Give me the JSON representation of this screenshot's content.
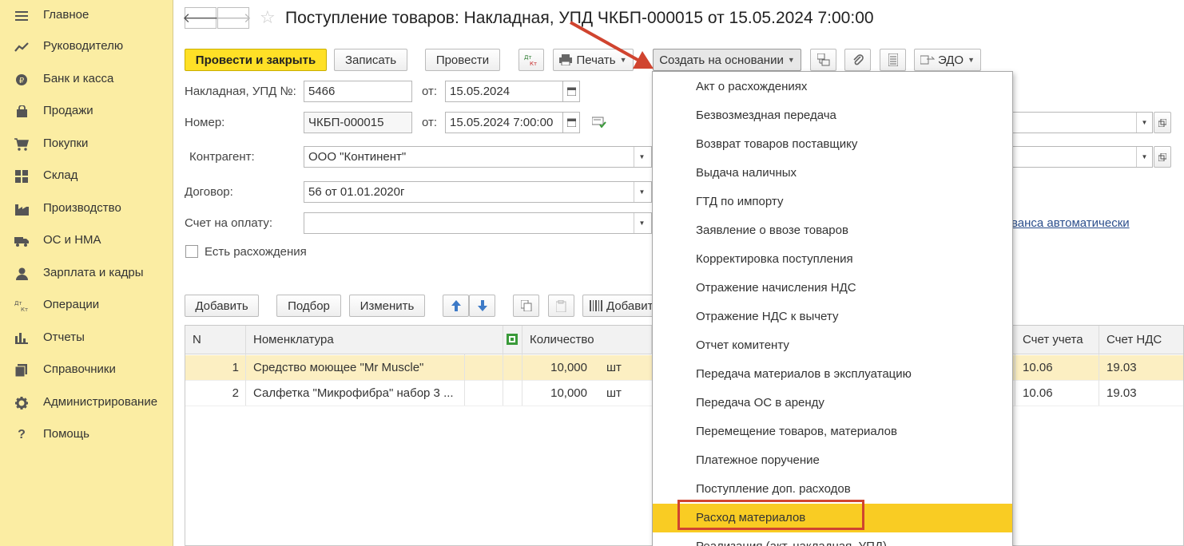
{
  "sidebar": {
    "items": [
      {
        "label": "Главное",
        "icon": "menu-icon"
      },
      {
        "label": "Руководителю",
        "icon": "trend-icon"
      },
      {
        "label": "Банк и касса",
        "icon": "coin-icon"
      },
      {
        "label": "Продажи",
        "icon": "shopping-bag-icon"
      },
      {
        "label": "Покупки",
        "icon": "cart-icon"
      },
      {
        "label": "Склад",
        "icon": "warehouse-icon"
      },
      {
        "label": "Производство",
        "icon": "factory-icon"
      },
      {
        "label": "ОС и НМА",
        "icon": "truck-icon"
      },
      {
        "label": "Зарплата и кадры",
        "icon": "person-icon"
      },
      {
        "label": "Операции",
        "icon": "dt-kt-icon"
      },
      {
        "label": "Отчеты",
        "icon": "bar-chart-icon"
      },
      {
        "label": "Справочники",
        "icon": "books-icon"
      },
      {
        "label": "Администрирование",
        "icon": "gear-icon"
      },
      {
        "label": "Помощь",
        "icon": "question-icon"
      }
    ]
  },
  "header": {
    "back": "🡐",
    "forward": "🡒",
    "title": "Поступление товаров: Накладная, УПД ЧКБП-000015 от 15.05.2024 7:00:00"
  },
  "toolbar": {
    "post_close": "Провести и закрыть",
    "save": "Записать",
    "post": "Провести",
    "dtkt": "Дт Кт",
    "print": "Печать",
    "create_based": "Создать на основании",
    "edo": "ЭДО"
  },
  "form": {
    "invoice_label": "Накладная, УПД №:",
    "invoice_value": "5466",
    "from_label": "от:",
    "invoice_date": "15.05.2024",
    "number_label": "Номер:",
    "number_value": "ЧКБП-000015",
    "number_date": "15.05.2024  7:00:00",
    "counterparty_label": "Контрагент:",
    "counterparty_value": "ООО \"Континент\"",
    "contract_label": "Договор:",
    "contract_value": "56 от 01.01.2020г",
    "payment_label": "Счет на оплату:",
    "payment_value": "",
    "discrepancies_label": "Есть расхождения",
    "advance_link": "ванса автоматически"
  },
  "table_toolbar": {
    "add": "Добавить",
    "pick": "Подбор",
    "edit": "Изменить",
    "add_barcode": "Добавит"
  },
  "table": {
    "headers": {
      "n": "N",
      "item": "Номенклатура",
      "qty": "Количество",
      "account": "Счет учета",
      "vat_account": "Счет НДС"
    },
    "rows": [
      {
        "n": "1",
        "item": "Средство моющее \"Mr Muscle\"",
        "qty": "10,000",
        "unit": "шт",
        "account": "10.06",
        "vat": "19.03"
      },
      {
        "n": "2",
        "item": "Салфетка \"Микрофибра\" набор 3 ...",
        "qty": "10,000",
        "unit": "шт",
        "account": "10.06",
        "vat": "19.03"
      }
    ]
  },
  "menu": {
    "items": [
      "Акт о расхождениях",
      "Безвозмездная передача",
      "Возврат товаров поставщику",
      "Выдача наличных",
      "ГТД по импорту",
      "Заявление о ввозе товаров",
      "Корректировка поступления",
      "Отражение начисления НДС",
      "Отражение НДС к вычету",
      "Отчет комитенту",
      "Передача материалов в эксплуатацию",
      "Передача ОС в аренду",
      "Перемещение товаров, материалов",
      "Платежное поручение",
      "Поступление доп. расходов",
      "Расход материалов",
      "Реализация (акт, накладная, УПД)"
    ],
    "highlighted": "Расход материалов"
  },
  "colors": {
    "sidebar": "#fbeda3",
    "primary_button": "#ffe026",
    "menu_highlight": "#f9cc23",
    "selected_row": "#fcefc2",
    "annotation_red": "#d0442f",
    "link": "#2b4e8c"
  }
}
